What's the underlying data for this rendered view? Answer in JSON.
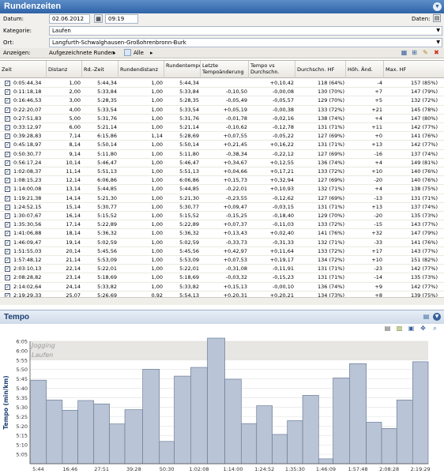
{
  "window": {
    "title": "Rundenzeiten",
    "menu_icon": "chevron-down-icon"
  },
  "form": {
    "datum_label": "Datum:",
    "datum_value": "02.06.2012",
    "time_value": "09:19",
    "daten_label": "Daten:",
    "kategorie_label": "Kategorie:",
    "kategorie_value": "Laufen",
    "ort_label": "Ort:",
    "ort_value": "Langfurth-Schwalghausen-Großohrenbronn-Burk"
  },
  "toolbar": {
    "anzeigen_label": "Anzeigen:",
    "view_value": "Aufgezeichnete Runden",
    "filter_value": "Alle"
  },
  "table": {
    "headers": [
      "Zeit",
      "Distanz",
      "Rd.-Zeit",
      "Rundendistanz",
      "Rundentempo",
      "Letzte Tempoänderung",
      "Tempo vs Durchschn.",
      "Durchschn. HF",
      "Höh. Änd.",
      "Max. HF"
    ],
    "rows": [
      [
        "0:05:44,34",
        "1,00",
        "5:44,34",
        "1,00",
        "5:44,34",
        "",
        "+0,10,42",
        "118 (64%)",
        "-4",
        "157 (85%)"
      ],
      [
        "0:11:18,18",
        "2,00",
        "5:33,84",
        "1,00",
        "5:33,84",
        "-0,10,50",
        "-0,00,08",
        "130 (70%)",
        "+7",
        "147 (79%)"
      ],
      [
        "0:16:46,53",
        "3,00",
        "5:28,35",
        "1,00",
        "5:28,35",
        "-0,05,49",
        "-0,05,57",
        "129 (70%)",
        "+5",
        "132 (72%)"
      ],
      [
        "0:22:20,07",
        "4,00",
        "5:33,54",
        "1,00",
        "5:33,54",
        "+0,05,19",
        "-0,00,38",
        "133 (72%)",
        "+21",
        "145 (78%)"
      ],
      [
        "0:27:51,83",
        "5,00",
        "5:31,76",
        "1,00",
        "5:31,76",
        "-0,01,78",
        "-0,02,16",
        "138 (74%)",
        "+4",
        "147 (80%)"
      ],
      [
        "0:33:12,97",
        "6,00",
        "5:21,14",
        "1,00",
        "5:21,14",
        "-0,10,62",
        "-0,12,78",
        "131 (71%)",
        "+11",
        "142 (77%)"
      ],
      [
        "0:39:28,83",
        "7,14",
        "6:15,86",
        "1,14",
        "5:28,69",
        "+0,07,55",
        "-0,05,22",
        "127 (69%)",
        "+0",
        "141 (76%)"
      ],
      [
        "0:45:18,97",
        "8,14",
        "5:50,14",
        "1,00",
        "5:50,14",
        "+0,21,45",
        "+0,16,22",
        "131 (71%)",
        "+13",
        "142 (77%)"
      ],
      [
        "0:50:30,77",
        "9,14",
        "5:11,80",
        "1,00",
        "5:11,80",
        "-0,38,34",
        "-0,22,12",
        "127 (69%)",
        "-16",
        "137 (74%)"
      ],
      [
        "0:56:17,24",
        "10,14",
        "5:46,47",
        "1,00",
        "5:46,47",
        "+0,34,67",
        "+0,12,55",
        "136 (74%)",
        "+4",
        "149 (81%)"
      ],
      [
        "1:02:08,37",
        "11,14",
        "5:51,13",
        "1,00",
        "5:51,13",
        "+0,04,66",
        "+0,17,21",
        "133 (72%)",
        "+10",
        "140 (76%)"
      ],
      [
        "1:08:15,23",
        "12,14",
        "6:06,86",
        "1,00",
        "6:06,86",
        "+0,15,73",
        "+0,32,94",
        "127 (69%)",
        "-20",
        "140 (76%)"
      ],
      [
        "1:14:00,08",
        "13,14",
        "5:44,85",
        "1,00",
        "5:44,85",
        "-0,22,01",
        "+0,10,93",
        "132 (71%)",
        "+4",
        "138 (75%)"
      ],
      [
        "1:19:21,38",
        "14,14",
        "5:21,30",
        "1,00",
        "5:21,30",
        "-0,23,55",
        "-0,12,62",
        "127 (69%)",
        "-13",
        "131 (71%)"
      ],
      [
        "1:24:52,15",
        "15,14",
        "5:30,77",
        "1,00",
        "5:30,77",
        "+0,09,47",
        "-0,03,15",
        "131 (71%)",
        "+13",
        "137 (74%)"
      ],
      [
        "1:30:07,67",
        "16,14",
        "5:15,52",
        "1,00",
        "5:15,52",
        "-0,15,25",
        "-0,18,40",
        "129 (70%)",
        "-20",
        "135 (73%)"
      ],
      [
        "1:35:30,56",
        "17,14",
        "5:22,89",
        "1,00",
        "5:22,89",
        "+0,07,37",
        "-0,11,03",
        "133 (72%)",
        "-15",
        "143 (77%)"
      ],
      [
        "1:41:06,88",
        "18,14",
        "5:36,32",
        "1,00",
        "5:36,32",
        "+0,13,43",
        "+0,02,40",
        "141 (76%)",
        "+32",
        "147 (79%)"
      ],
      [
        "1:46:09,47",
        "19,14",
        "5:02,59",
        "1,00",
        "5:02,59",
        "-0,33,73",
        "-0,31,33",
        "132 (71%)",
        "-33",
        "141 (76%)"
      ],
      [
        "1:51:55,03",
        "20,14",
        "5:45,56",
        "1,00",
        "5:45,56",
        "+0,42,97",
        "+0,11,64",
        "133 (72%)",
        "+17",
        "143 (77%)"
      ],
      [
        "1:57:48,12",
        "21,14",
        "5:53,09",
        "1,00",
        "5:53,09",
        "+0,07,53",
        "+0,19,17",
        "134 (72%)",
        "+10",
        "151 (82%)"
      ],
      [
        "2:03:10,13",
        "22,14",
        "5:22,01",
        "1,00",
        "5:22,01",
        "-0,31,08",
        "-0,11,91",
        "131 (71%)",
        "-23",
        "142 (77%)"
      ],
      [
        "2:08:28,82",
        "23,14",
        "5:18,69",
        "1,00",
        "5:18,69",
        "-0,03,32",
        "-0,15,23",
        "131 (71%)",
        "-14",
        "135 (73%)"
      ],
      [
        "2:14:02,64",
        "24,14",
        "5:33,82",
        "1,00",
        "5:33,82",
        "+0,15,13",
        "-0,00,10",
        "136 (74%)",
        "+9",
        "142 (77%)"
      ],
      [
        "2:19:29,33",
        "25,07",
        "5:26,69",
        "0,92",
        "5:54,13",
        "+0,20,31",
        "+0,20,21",
        "134 (73%)",
        "+8",
        "139 (75%)"
      ]
    ]
  },
  "chart_panel": {
    "title": "Tempo"
  },
  "chart_data": {
    "type": "bar",
    "ylabel": "Tempo (min/km)",
    "ylim": [
      5.0,
      6.083
    ],
    "yticks": [
      "5:05",
      "5:10",
      "5:15",
      "5:20",
      "5:25",
      "5:30",
      "5:35",
      "5:40",
      "5:45",
      "5:50",
      "5:55",
      "6:00",
      "6:05"
    ],
    "xticks": [
      "5:44",
      "16:46",
      "27:51",
      "39:28",
      "50:30",
      "1:02:08",
      "1:14:00",
      "1:24:52",
      "1:35:30",
      "1:46:09",
      "1:57:48",
      "2:08:28",
      "2:19:29"
    ],
    "zones": [
      {
        "label": "Jogging",
        "from": 6.0,
        "to": 6.083
      },
      {
        "label": "Laufen",
        "from": 5.917,
        "to": 6.0
      }
    ],
    "values": [
      5.739,
      5.564,
      5.473,
      5.559,
      5.529,
      5.352,
      5.478,
      5.836,
      5.197,
      5.775,
      5.852,
      6.114,
      5.748,
      5.355,
      5.513,
      5.259,
      5.381,
      5.605,
      5.043,
      5.759,
      5.885,
      5.367,
      5.312,
      5.564,
      5.902
    ],
    "x_starts": [
      0,
      5.74,
      11.3,
      16.78,
      22.33,
      27.86,
      33.22,
      39.48,
      45.32,
      50.51,
      56.29,
      62.14,
      68.25,
      74.0,
      79.36,
      84.87,
      90.13,
      95.51,
      101.11,
      106.16,
      111.92,
      117.8,
      123.17,
      128.48,
      134.04
    ],
    "x_ends": [
      5.74,
      11.3,
      16.78,
      22.33,
      27.86,
      33.22,
      39.48,
      45.32,
      50.51,
      56.29,
      62.14,
      68.25,
      74.0,
      79.36,
      84.87,
      90.13,
      95.51,
      101.11,
      106.16,
      111.92,
      117.8,
      123.17,
      128.48,
      134.04,
      139.49
    ],
    "bar_color": "#b9c4d6",
    "zone_color": "#e7e6e3",
    "grid": true
  }
}
